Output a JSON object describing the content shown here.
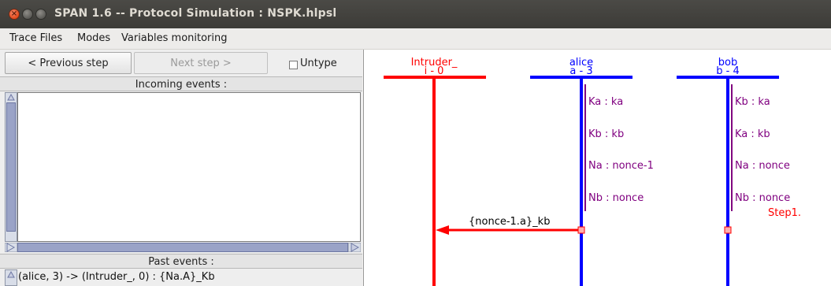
{
  "window": {
    "title": "SPAN 1.6 -- Protocol Simulation : NSPK.hlpsl"
  },
  "menu": {
    "items": [
      "Trace Files",
      "Modes",
      "Variables monitoring"
    ]
  },
  "controls": {
    "previous_label": "< Previous step",
    "next_label": "Next step >",
    "untype_label": "Untype",
    "untype_checked": false
  },
  "incoming": {
    "header": "Incoming events :",
    "items": []
  },
  "past": {
    "header": "Past events :",
    "items": [
      "(alice, 3) -> (Intruder_, 0) : {Na.A}_Kb"
    ]
  },
  "diagram": {
    "roles": [
      {
        "name": "Intruder_",
        "id": "i - 0",
        "color": "#ff0000",
        "variables": []
      },
      {
        "name": "alice",
        "id": "a - 3",
        "color": "#0000ff",
        "variables": [
          "Ka : ka",
          "Kb : kb",
          "Na : nonce-1",
          "Nb : nonce"
        ]
      },
      {
        "name": "bob",
        "id": "b - 4",
        "color": "#0000ff",
        "variables": [
          "Kb : ka",
          "Ka : kb",
          "Na : nonce",
          "Nb : nonce"
        ]
      }
    ],
    "messages": [
      {
        "label": "{nonce-1.a}_kb",
        "from": "alice",
        "to": "Intruder_"
      }
    ],
    "step_label": "Step1.",
    "variable_color": "#800080",
    "step_color": "#ff0000"
  }
}
